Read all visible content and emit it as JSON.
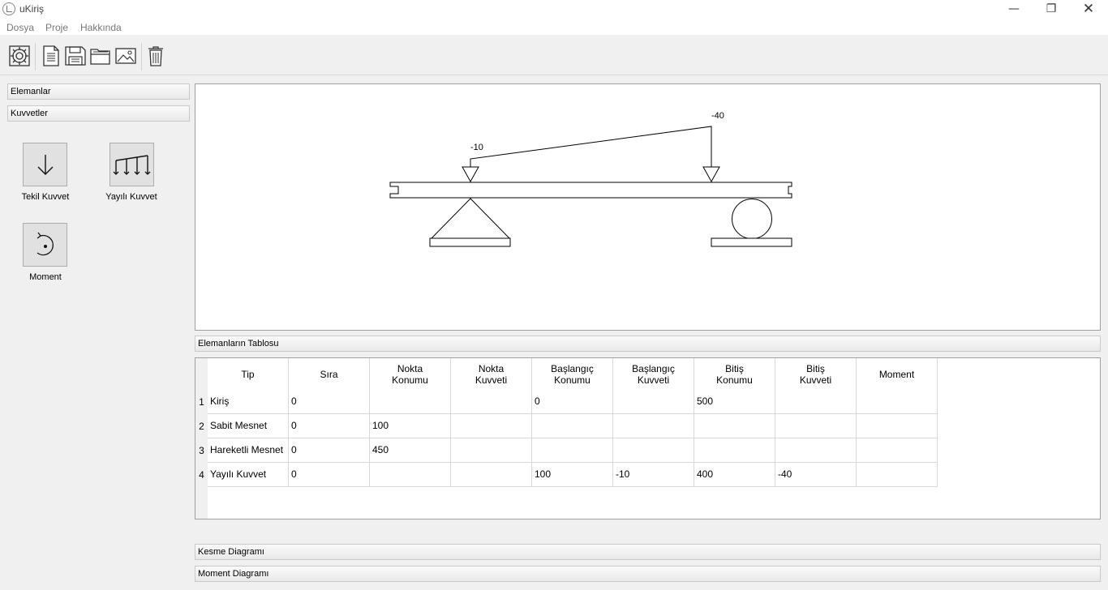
{
  "window": {
    "title": "uKiriş",
    "minimize_glyph": "—",
    "maximize_glyph": "❐",
    "close_glyph": "✕"
  },
  "menu": [
    "Dosya",
    "Proje",
    "Hakkında"
  ],
  "toolbar": {
    "icons": [
      "gear-icon",
      "new-document-icon",
      "save-icon",
      "open-folder-icon",
      "image-icon",
      "trash-icon"
    ]
  },
  "left_panel": {
    "sections": [
      "Elemanlar",
      "Kuvvetler"
    ],
    "items": [
      {
        "label": "Tekil Kuvvet",
        "icon": "arrow-down-icon"
      },
      {
        "label": "Yayılı Kuvvet",
        "icon": "distributed-load-icon"
      },
      {
        "label": "Moment",
        "icon": "moment-icon"
      }
    ]
  },
  "diagram": {
    "load_start_label": "-10",
    "load_end_label": "-40"
  },
  "table": {
    "header": "Elemanların Tablosu",
    "columns": [
      "Tip",
      "Sıra",
      "Nokta\nKonumu",
      "Nokta\nKuvveti",
      "Başlangıç\nKonumu",
      "Başlangıç\nKuvveti",
      "Bitiş\nKonumu",
      "Bitiş\nKuvveti",
      "Moment"
    ],
    "rows": [
      {
        "num": "1",
        "cells": [
          "Kiriş",
          "0",
          "",
          "",
          "0",
          "",
          "500",
          "",
          ""
        ]
      },
      {
        "num": "2",
        "cells": [
          "Sabit Mesnet",
          "0",
          "100",
          "",
          "",
          "",
          "",
          "",
          ""
        ]
      },
      {
        "num": "3",
        "cells": [
          "Hareketli Mesnet",
          "0",
          "450",
          "",
          "",
          "",
          "",
          "",
          ""
        ]
      },
      {
        "num": "4",
        "cells": [
          "Yayılı Kuvvet",
          "0",
          "",
          "",
          "100",
          "-10",
          "400",
          "-40",
          ""
        ]
      }
    ]
  },
  "bottom_sections": [
    "Kesme Diagramı",
    "Moment Diagramı"
  ]
}
